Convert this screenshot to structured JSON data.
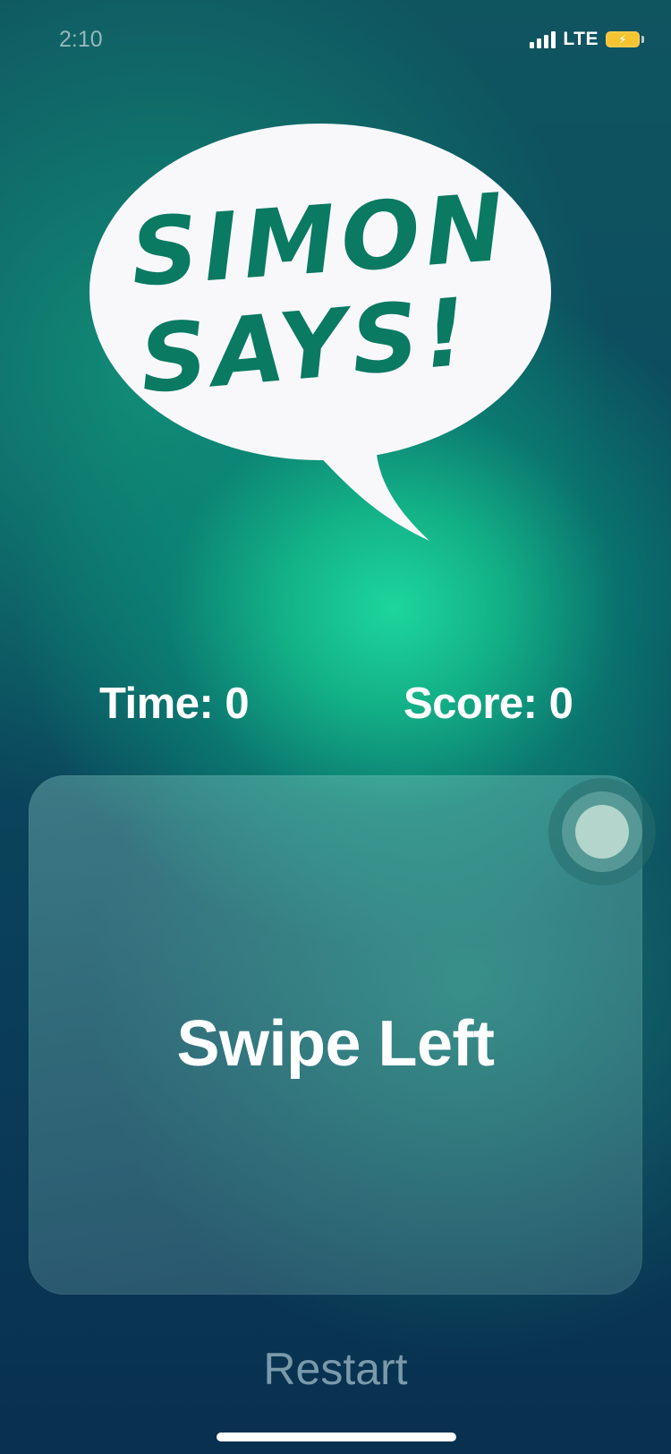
{
  "status_bar": {
    "time": "2:10",
    "network": "LTE",
    "icons": [
      "signal-icon",
      "battery-charging-icon"
    ]
  },
  "logo": {
    "line1": "SIMON",
    "line2": "SAYS!",
    "text_color": "#0a7a62",
    "bubble_color": "#f8f8fb"
  },
  "stats": {
    "time_label": "Time: 0",
    "score_label": "Score: 0"
  },
  "card": {
    "instruction": "Swipe Left"
  },
  "restart_label": "Restart",
  "colors": {
    "accent_green": "#1ed6a0",
    "background_dark": "#0a3d58"
  }
}
